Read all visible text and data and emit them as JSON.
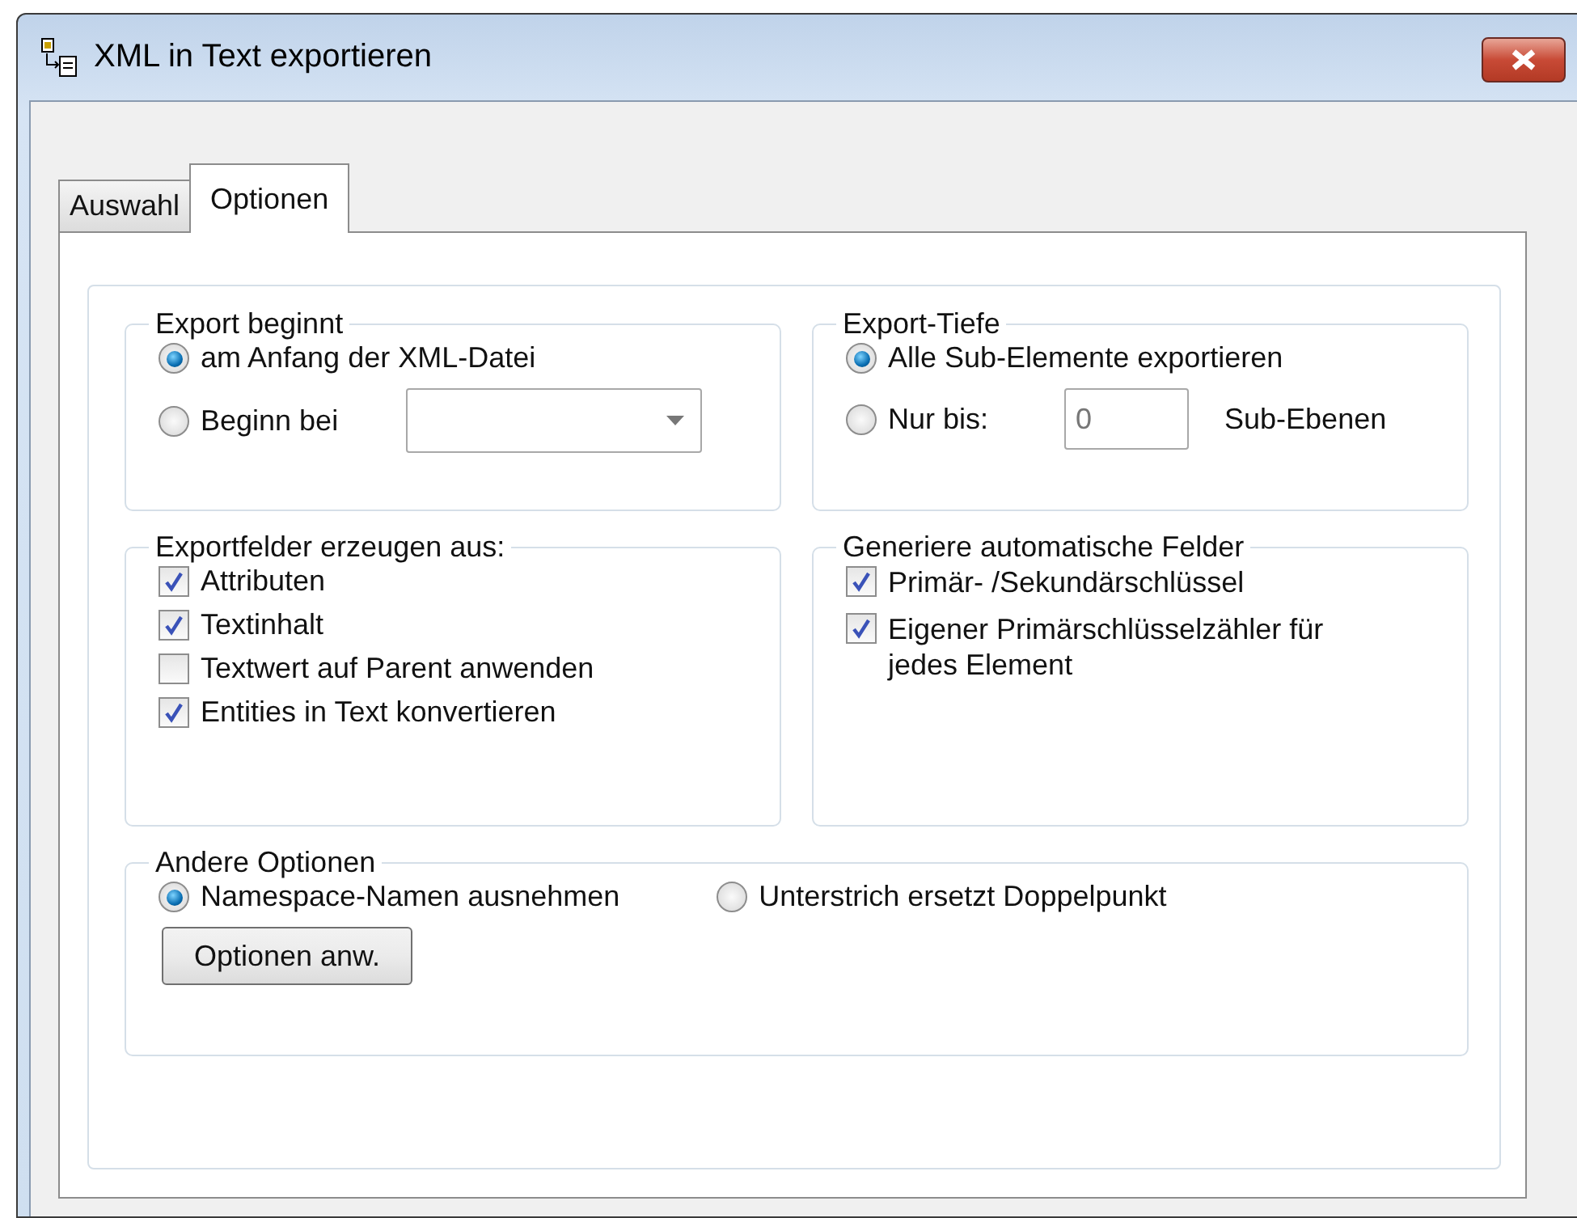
{
  "window": {
    "title": "XML in Text exportieren"
  },
  "tabs": [
    {
      "label": "Auswahl",
      "selected": false
    },
    {
      "label": "Optionen",
      "selected": true
    }
  ],
  "groups": [
    {
      "title": "Export beginnt",
      "items": [
        {
          "kind": "radio",
          "label": "am Anfang der XML-Datei",
          "selected": true
        },
        {
          "kind": "radio_dropdown",
          "label": "Beginn bei",
          "selected": false
        }
      ]
    },
    {
      "title": "Export-Tiefe",
      "items": [
        {
          "kind": "radio",
          "label": "Alle Sub-Elemente exportieren",
          "selected": true
        },
        {
          "kind": "radio_number",
          "label": "Nur bis:",
          "selected": false,
          "value": "0",
          "suffix": "Sub-Ebenen"
        }
      ]
    },
    {
      "title": "Exportfelder erzeugen aus:",
      "items": [
        {
          "kind": "checkbox",
          "label": "Attributen",
          "checked": true
        },
        {
          "kind": "checkbox",
          "label": "Textinhalt",
          "checked": true
        },
        {
          "kind": "checkbox",
          "label": "Textwert auf Parent anwenden",
          "checked": false
        },
        {
          "kind": "checkbox",
          "label": "Entities in Text konvertieren",
          "checked": true
        }
      ]
    },
    {
      "title": "Generiere automatische Felder",
      "items": [
        {
          "kind": "checkbox",
          "label": "Primär- /Sekundärschlüssel",
          "checked": true
        },
        {
          "kind": "checkbox",
          "label": "Eigener Primärschlüsselzähler für jedes Element",
          "checked": true
        }
      ]
    }
  ],
  "other": {
    "title": "Andere Optionen",
    "options": [
      {
        "label": "Namespace-Namen ausnehmen",
        "selected": true
      },
      {
        "label": "Unterstrich ersetzt Doppelpunkt",
        "selected": false
      }
    ],
    "button": "Optionen anw."
  }
}
